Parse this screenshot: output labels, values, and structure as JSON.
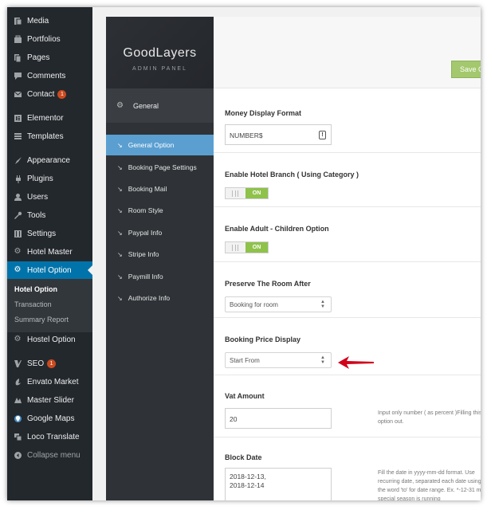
{
  "wp_menu": {
    "items": [
      {
        "label": "Media",
        "icon": "media-icon"
      },
      {
        "label": "Portfolios",
        "icon": "portfolio-icon"
      },
      {
        "label": "Pages",
        "icon": "pages-icon"
      },
      {
        "label": "Comments",
        "icon": "comments-icon"
      },
      {
        "label": "Contact",
        "icon": "mail-icon",
        "badge": "1"
      },
      {
        "label": "Elementor",
        "icon": "elementor-icon"
      },
      {
        "label": "Templates",
        "icon": "templates-icon"
      },
      {
        "label": "Appearance",
        "icon": "appearance-icon"
      },
      {
        "label": "Plugins",
        "icon": "plugins-icon"
      },
      {
        "label": "Users",
        "icon": "users-icon"
      },
      {
        "label": "Tools",
        "icon": "tools-icon"
      },
      {
        "label": "Settings",
        "icon": "settings-icon"
      },
      {
        "label": "Hotel Master",
        "icon": "gear-icon"
      },
      {
        "label": "Hotel Option",
        "icon": "gear-icon",
        "active": true
      },
      {
        "label": "Hostel Option",
        "icon": "gear-icon"
      },
      {
        "label": "SEO",
        "icon": "seo-icon",
        "badge": "1"
      },
      {
        "label": "Envato Market",
        "icon": "envato-icon"
      },
      {
        "label": "Master Slider",
        "icon": "slider-icon"
      },
      {
        "label": "Google Maps",
        "icon": "maps-icon"
      },
      {
        "label": "Loco Translate",
        "icon": "translate-icon"
      },
      {
        "label": "Collapse menu",
        "icon": "collapse-icon"
      }
    ],
    "submenu": [
      "Hotel Option",
      "Transaction",
      "Summary Report"
    ]
  },
  "panel": {
    "logo": "GoodLayers",
    "sublogo": "ADMIN PANEL",
    "save_label": "Save C"
  },
  "panel_nav": {
    "section": "General",
    "items": [
      "General Option",
      "Booking Page Settings",
      "Booking Mail",
      "Room Style",
      "Paypal Info",
      "Stripe Info",
      "Paymill Info",
      "Authorize Info"
    ]
  },
  "options": {
    "money_format": {
      "title": "Money Display Format",
      "value": "NUMBER$",
      "alert": "!"
    },
    "hotel_branch": {
      "title": "Enable Hotel Branch ( Using Category )",
      "state": "ON"
    },
    "adult_children": {
      "title": "Enable Adult - Children Option",
      "state": "ON"
    },
    "preserve_room": {
      "title": "Preserve The Room After",
      "value": "Booking for room"
    },
    "booking_price": {
      "title": "Booking Price Display",
      "value": "Start From"
    },
    "vat_amount": {
      "title": "Vat Amount",
      "value": "20",
      "description": "Input only number ( as percent )Filling this option out."
    },
    "block_date": {
      "title": "Block Date",
      "value_line1": "2018-12-13,",
      "value_line2": "2018-12-14",
      "description": "Fill the date in yyyy-mm-dd format. Use recurring date, separated each date using use the word 'to' for date range. Ex. *-12-31 means special season is running"
    }
  },
  "colors": {
    "wp_sidebar": "#23282d",
    "wp_active": "#0073aa",
    "panel_nav": "#2f3337",
    "panel_nav_active": "#5b9fd1",
    "toggle_on": "#8fc24b",
    "save_button": "#a3c86d",
    "badge": "#ca4a1f",
    "annotation_arrow": "#d0021b"
  }
}
